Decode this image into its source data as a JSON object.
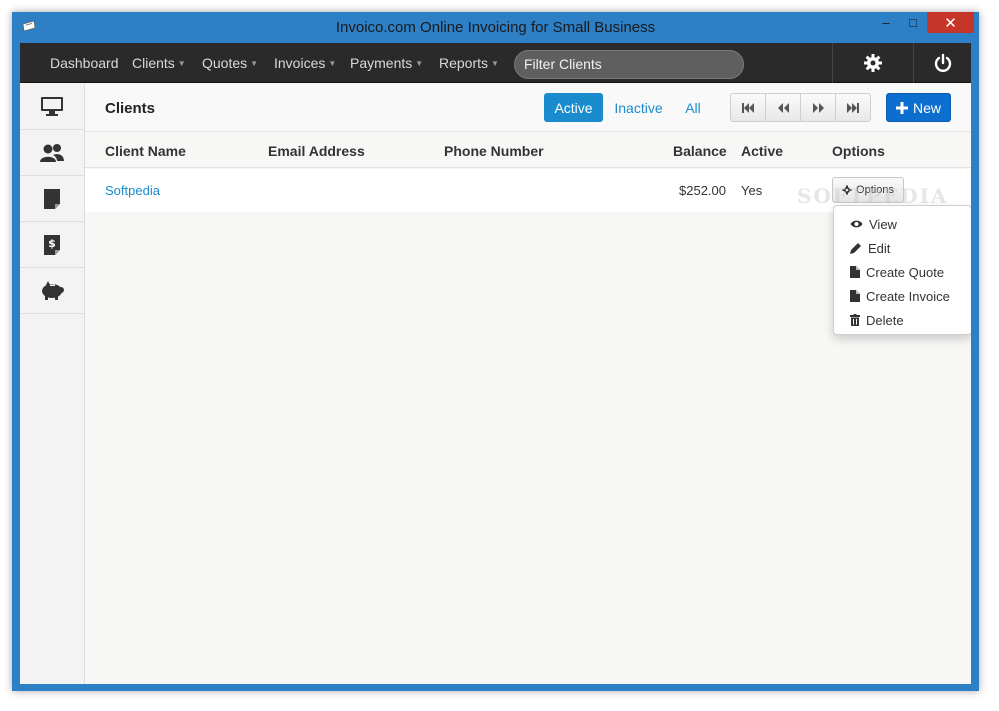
{
  "window": {
    "title": "Invoico.com Online Invoicing for Small Business",
    "minimize_glyph": "–",
    "maximize_glyph": "□",
    "close_glyph": "✕"
  },
  "nav": {
    "items": [
      {
        "label": "Dashboard",
        "has_caret": false
      },
      {
        "label": "Clients",
        "has_caret": true
      },
      {
        "label": "Quotes",
        "has_caret": true
      },
      {
        "label": "Invoices",
        "has_caret": true
      },
      {
        "label": "Payments",
        "has_caret": true
      },
      {
        "label": "Reports",
        "has_caret": true
      }
    ],
    "filter_placeholder": "Filter Clients",
    "settings_icon": "gear-icon",
    "logout_icon": "power-icon"
  },
  "sidebar": {
    "items": [
      "monitor-icon",
      "users-icon",
      "quote-document-icon",
      "invoice-dollar-icon",
      "piggy-bank-icon"
    ]
  },
  "toolbar": {
    "title": "Clients",
    "filters": [
      {
        "label": "Active",
        "active": true
      },
      {
        "label": "Inactive",
        "active": false
      },
      {
        "label": "All",
        "active": false
      }
    ],
    "pager_icons": [
      "first-page-icon",
      "previous-page-icon",
      "next-page-icon",
      "last-page-icon"
    ],
    "new_label": "New"
  },
  "table": {
    "columns": [
      "Client Name",
      "Email Address",
      "Phone Number",
      "Balance",
      "Active",
      "Options"
    ],
    "rows": [
      {
        "name": "Softpedia",
        "email": "",
        "phone": "",
        "balance": "$252.00",
        "active": "Yes",
        "options_label": "Options"
      }
    ]
  },
  "options_menu": {
    "items": [
      {
        "label": "View",
        "icon": "eye-icon"
      },
      {
        "label": "Edit",
        "icon": "pencil-icon"
      },
      {
        "label": "Create Quote",
        "icon": "document-icon"
      },
      {
        "label": "Create Invoice",
        "icon": "document-icon"
      },
      {
        "label": "Delete",
        "icon": "trash-icon"
      }
    ]
  },
  "watermark": "SOFTPEDIA",
  "colors": {
    "accent": "#1a8ccd",
    "new_button": "#0c6fd0",
    "navbar": "#2a2a2a",
    "window_frame": "#2d7fc6",
    "close_button": "#c7342a"
  }
}
